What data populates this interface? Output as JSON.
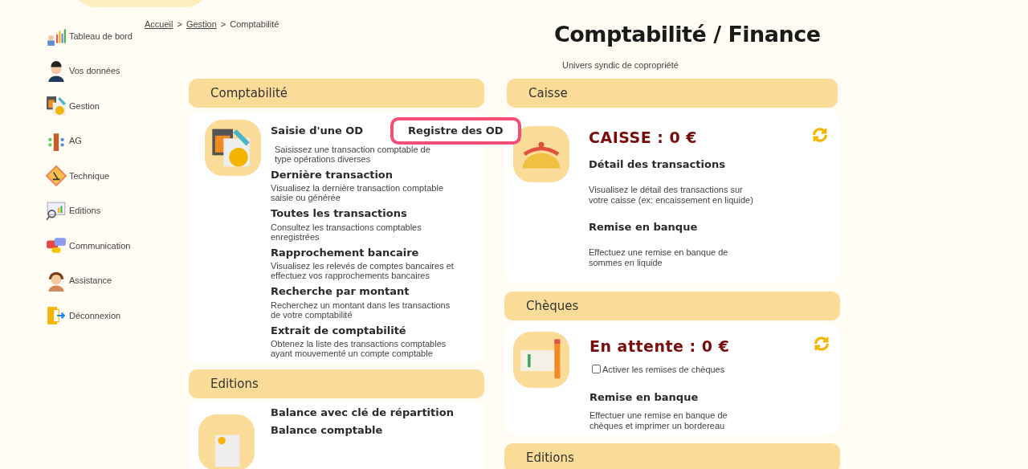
{
  "sidebar": {
    "items": [
      {
        "label": "Tableau de bord"
      },
      {
        "label": "Vos données"
      },
      {
        "label": "Gestion"
      },
      {
        "label": "AG"
      },
      {
        "label": "Technique"
      },
      {
        "label": "Editions"
      },
      {
        "label": "Communication"
      },
      {
        "label": "Assistance"
      },
      {
        "label": "Déconnexion"
      }
    ]
  },
  "breadcrumb": {
    "links": [
      "Accueil",
      "Gestion"
    ],
    "separator": ">",
    "current": "Comptabilité"
  },
  "page": {
    "title": "Comptabilité / Finance",
    "subtitle": "Univers syndic de copropriété"
  },
  "left_column": [
    {
      "title": "Comptabilité",
      "items": [
        {
          "title": "Saisie d'une OD",
          "description": "Saisissez une transaction comptable de type opérations diverses",
          "side_link": {
            "label": "Registre des OD",
            "highlighted": true
          }
        },
        {
          "title": "Dernière transaction",
          "description": "Visualisez la dernière transaction comptable saisie ou générée"
        },
        {
          "title": "Toutes les transactions",
          "description": "Consultez les transactions comptables enregistrées"
        },
        {
          "title": "Rapprochement bancaire",
          "description": "Visualisez les relevés de comptes bancaires et effectuez vos rapprochements bancaires"
        },
        {
          "title": "Recherche par montant",
          "description": "Recherchez un montant dans les transactions de votre comptabilité"
        },
        {
          "title": "Extrait de comptabilité",
          "description": "Obtenez la liste des transactions comptables ayant mouvementé un compte comptable"
        }
      ]
    },
    {
      "title": "Editions",
      "items": [
        {
          "title": "Balance avec clé de répartition"
        },
        {
          "title": "Balance comptable"
        }
      ]
    }
  ],
  "caisse": {
    "title": "Caisse",
    "amount": "CAISSE : 0 €",
    "items": [
      {
        "title": "Détail des transactions",
        "description": "Visualisez le détail des transactions sur votre caisse (ex: encaissement en liquide)"
      },
      {
        "title": "Remise en banque",
        "description": "Effectuez une remise en banque de sommes en liquide"
      }
    ]
  },
  "cheques": {
    "title": "Chèques",
    "amount": "En attente : 0 €",
    "checkbox": {
      "label": "Activer les remises de chèques",
      "checked": false
    },
    "items": [
      {
        "title": "Remise en banque",
        "description": "Effectuer une remise en banque de chèques et imprimer un bordereau"
      }
    ]
  },
  "right_editions": {
    "title": "Editions"
  }
}
